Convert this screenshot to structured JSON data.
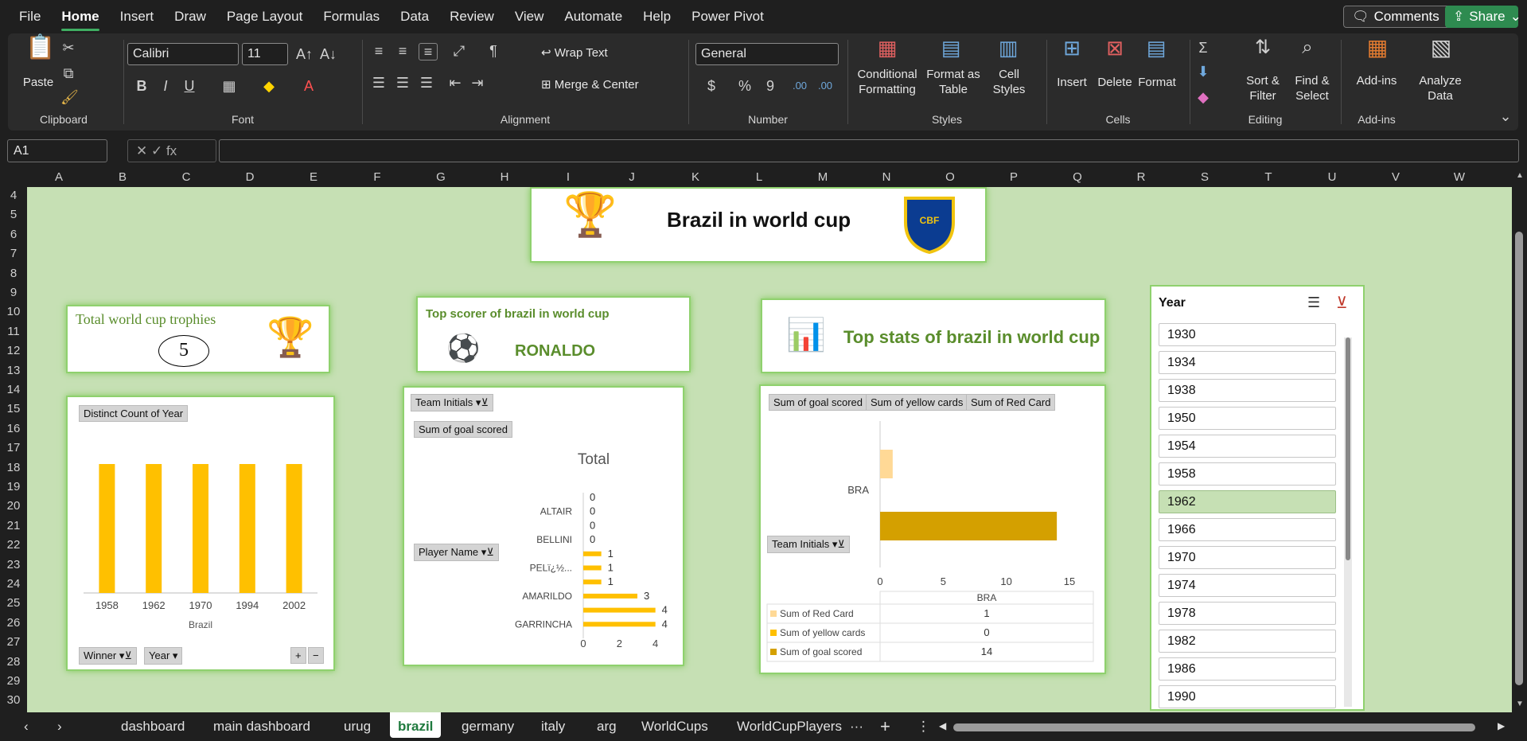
{
  "menu": {
    "tabs": [
      "File",
      "Home",
      "Insert",
      "Draw",
      "Page Layout",
      "Formulas",
      "Data",
      "Review",
      "View",
      "Automate",
      "Help",
      "Power Pivot"
    ],
    "comments": "Comments",
    "share": "Share"
  },
  "ribbon": {
    "clipboard": {
      "paste": "Paste",
      "label": "Clipboard"
    },
    "font": {
      "name": "Calibri",
      "size": "11",
      "label": "Font",
      "bold": "B",
      "italic": "I",
      "underline": "U"
    },
    "alignment": {
      "wrap": "Wrap Text",
      "merge": "Merge & Center",
      "label": "Alignment"
    },
    "number": {
      "format": "General",
      "label": "Number",
      "currency": "$",
      "percent": "%",
      "comma": "9",
      "inc_dec": ".00",
      "dec_dec": ".00"
    },
    "styles": {
      "conditional": "Conditional",
      "conditional2": "Formatting",
      "format_as": "Format as",
      "format_as2": "Table",
      "cell": "Cell",
      "cell2": "Styles",
      "label": "Styles"
    },
    "cells": {
      "insert": "Insert",
      "delete": "Delete",
      "format": "Format",
      "label": "Cells"
    },
    "editing": {
      "sort": "Sort &",
      "sort2": "Filter",
      "find": "Find &",
      "find2": "Select",
      "label": "Editing"
    },
    "addins": {
      "addins": "Add-ins",
      "label": "Add-ins"
    },
    "analyze": {
      "line1": "Analyze",
      "line2": "Data"
    }
  },
  "formula_bar": {
    "name_box": "A1",
    "formula": ""
  },
  "columns": [
    "A",
    "B",
    "C",
    "D",
    "E",
    "F",
    "G",
    "H",
    "I",
    "J",
    "K",
    "L",
    "M",
    "N",
    "O",
    "P",
    "Q",
    "R",
    "S",
    "T",
    "U",
    "V",
    "W"
  ],
  "rows": [
    "4",
    "5",
    "6",
    "7",
    "8",
    "9",
    "10",
    "11",
    "12",
    "13",
    "14",
    "15",
    "16",
    "17",
    "18",
    "19",
    "20",
    "21",
    "22",
    "23",
    "24",
    "25",
    "26",
    "27",
    "28",
    "29",
    "30"
  ],
  "dashboard": {
    "title": "Brazil in world cup",
    "trophies": {
      "label": "Total world cup trophies",
      "value": "5"
    },
    "scorer": {
      "label": "Top scorer of brazil in world cup",
      "value": "RONALDO"
    },
    "stats_title": "Top stats of brazil in world cup",
    "chart1": {
      "field": "Distinct Count of Year",
      "filter1": "Winner",
      "filter2": "Year",
      "expand": "+",
      "collapse": "−"
    },
    "chart2": {
      "filter": "Team Initials",
      "measure": "Sum of goal scored",
      "title": "Total",
      "row_field": "Player Name",
      "names": [
        "ALTAIR",
        "BELLINI",
        "PELï¿½...",
        "AMARILDO",
        "GARRINCHA"
      ],
      "xticks": [
        "0",
        "2",
        "4",
        "6"
      ]
    },
    "chart3": {
      "buttons": [
        "Sum of goal scored",
        "Sum of yellow cards",
        "Sum of Red Card"
      ],
      "category": "BRA",
      "filter": "Team Initials",
      "xticks": [
        "0",
        "5",
        "10",
        "15"
      ],
      "table": {
        "header": "BRA",
        "rows": [
          {
            "name": "Sum of Red Card",
            "value": "1",
            "color": "#ffd996"
          },
          {
            "name": "Sum of yellow cards",
            "value": "0",
            "color": "#ffc000"
          },
          {
            "name": "Sum of goal scored",
            "value": "14",
            "color": "#d4a000"
          }
        ]
      }
    }
  },
  "chart_data": [
    {
      "type": "bar",
      "categories": [
        "1958",
        "1962",
        "1970",
        "1994",
        "2002"
      ],
      "values": [
        1,
        1,
        1,
        1,
        1
      ],
      "xlabel": "Brazil",
      "ylabel": "",
      "title": ""
    },
    {
      "type": "bar",
      "orientation": "horizontal",
      "title": "Total",
      "categories": [
        "",
        "ALTAIR",
        "",
        "BELLINI",
        "",
        "PELï¿½...",
        "",
        "AMARILDO",
        "",
        "GARRINCHA"
      ],
      "values": [
        0,
        0,
        0,
        0,
        1,
        1,
        1,
        3,
        4,
        4
      ],
      "data_labels": [
        "0",
        "0",
        "0",
        "0",
        "1",
        "1",
        "1",
        "3",
        "4",
        "4"
      ],
      "xlim": [
        0,
        6
      ]
    },
    {
      "type": "bar",
      "orientation": "horizontal",
      "categories": [
        "BRA"
      ],
      "series": [
        {
          "name": "Sum of Red Card",
          "values": [
            1
          ]
        },
        {
          "name": "Sum of yellow cards",
          "values": [
            0
          ]
        },
        {
          "name": "Sum of goal scored",
          "values": [
            14
          ]
        }
      ],
      "xlim": [
        0,
        15
      ]
    }
  ],
  "slicer": {
    "title": "Year",
    "items": [
      "1930",
      "1934",
      "1938",
      "1950",
      "1954",
      "1958",
      "1962",
      "1966",
      "1970",
      "1974",
      "1978",
      "1982",
      "1986",
      "1990"
    ],
    "selected": "1962"
  },
  "sheets": {
    "tabs": [
      "dashboard",
      "main dashboard",
      "urug",
      "brazil",
      "germany",
      "italy",
      "arg",
      "WorldCups",
      "WorldCupPlayers"
    ],
    "active": "brazil",
    "more": "···",
    "add": "+"
  }
}
